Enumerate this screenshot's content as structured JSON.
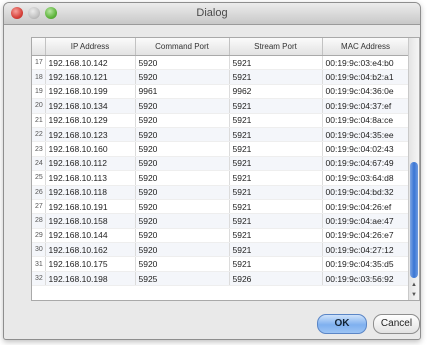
{
  "window": {
    "title": "Dialog"
  },
  "table": {
    "columns": [
      "IP Address",
      "Command Port",
      "Stream Port",
      "MAC Address"
    ],
    "rows": [
      {
        "n": "17",
        "ip": "192.168.10.142",
        "cmd": "5920",
        "stream": "5921",
        "mac": "00:19:9c:03:e4:b0"
      },
      {
        "n": "18",
        "ip": "192.168.10.121",
        "cmd": "5920",
        "stream": "5921",
        "mac": "00:19:9c:04:b2:a1"
      },
      {
        "n": "19",
        "ip": "192.168.10.199",
        "cmd": "9961",
        "stream": "9962",
        "mac": "00:19:9c:04:36:0e"
      },
      {
        "n": "20",
        "ip": "192.168.10.134",
        "cmd": "5920",
        "stream": "5921",
        "mac": "00:19:9c:04:37:ef"
      },
      {
        "n": "21",
        "ip": "192.168.10.129",
        "cmd": "5920",
        "stream": "5921",
        "mac": "00:19:9c:04:8a:ce"
      },
      {
        "n": "22",
        "ip": "192.168.10.123",
        "cmd": "5920",
        "stream": "5921",
        "mac": "00:19:9c:04:35:ee"
      },
      {
        "n": "23",
        "ip": "192.168.10.160",
        "cmd": "5920",
        "stream": "5921",
        "mac": "00:19:9c:04:02:43"
      },
      {
        "n": "24",
        "ip": "192.168.10.112",
        "cmd": "5920",
        "stream": "5921",
        "mac": "00:19:9c:04:67:49"
      },
      {
        "n": "25",
        "ip": "192.168.10.113",
        "cmd": "5920",
        "stream": "5921",
        "mac": "00:19:9c:03:64:d8"
      },
      {
        "n": "26",
        "ip": "192.168.10.118",
        "cmd": "5920",
        "stream": "5921",
        "mac": "00:19:9c:04:bd:32"
      },
      {
        "n": "27",
        "ip": "192.168.10.191",
        "cmd": "5920",
        "stream": "5921",
        "mac": "00:19:9c:04:26:ef"
      },
      {
        "n": "28",
        "ip": "192.168.10.158",
        "cmd": "5920",
        "stream": "5921",
        "mac": "00:19:9c:04:ae:47"
      },
      {
        "n": "29",
        "ip": "192.168.10.144",
        "cmd": "5920",
        "stream": "5921",
        "mac": "00:19:9c:04:26:e7"
      },
      {
        "n": "30",
        "ip": "192.168.10.162",
        "cmd": "5920",
        "stream": "5921",
        "mac": "00:19:9c:04:27:12"
      },
      {
        "n": "31",
        "ip": "192.168.10.175",
        "cmd": "5920",
        "stream": "5921",
        "mac": "00:19:9c:04:35:d5"
      },
      {
        "n": "32",
        "ip": "192.168.10.198",
        "cmd": "5925",
        "stream": "5926",
        "mac": "00:19:9c:03:56:92"
      }
    ]
  },
  "buttons": {
    "ok": "OK",
    "cancel": "Cancel"
  },
  "icons": {
    "close": "close-icon",
    "minimize": "minimize-icon",
    "zoom": "zoom-icon",
    "scroll_up": "arrow-up-icon",
    "scroll_down": "arrow-down-icon"
  },
  "colors": {
    "default_button": "#7fb0ef",
    "scroll_thumb": "#3a76d4",
    "close_button": "#d6413a"
  }
}
